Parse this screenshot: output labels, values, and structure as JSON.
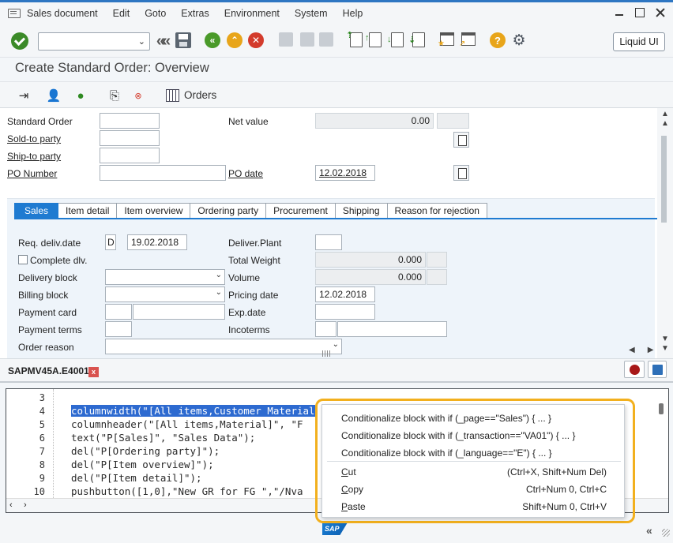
{
  "menu": [
    "Sales document",
    "Edit",
    "Goto",
    "Extras",
    "Environment",
    "System",
    "Help"
  ],
  "toolbar": {
    "liquid_ui": "Liquid UI"
  },
  "title": "Create Standard Order: Overview",
  "toolbar2": {
    "orders": "Orders"
  },
  "header": {
    "standard_order": "Standard Order",
    "sold_to": "Sold-to party",
    "ship_to": "Ship-to party",
    "po_number": "PO Number",
    "net_value": "Net value",
    "net_value_val": "0.00",
    "po_date": "PO date",
    "po_date_val": "12.02.2018"
  },
  "tabs": [
    "Sales",
    "Item detail",
    "Item overview",
    "Ordering party",
    "Procurement",
    "Shipping",
    "Reason for rejection"
  ],
  "sales": {
    "req_deliv": "Req. deliv.date",
    "req_deliv_d": "D",
    "req_deliv_val": "19.02.2018",
    "complete_dlv": "Complete dlv.",
    "delivery_block": "Delivery block",
    "billing_block": "Billing block",
    "payment_card": "Payment card",
    "payment_terms": "Payment terms",
    "order_reason": "Order reason",
    "deliver_plant": "Deliver.Plant",
    "total_weight": "Total Weight",
    "total_weight_val": "0.000",
    "volume": "Volume",
    "volume_val": "0.000",
    "pricing_date": "Pricing date",
    "pricing_date_val": "12.02.2018",
    "exp_date": "Exp.date",
    "incoterms": "Incoterms"
  },
  "editor": {
    "tab_title": "SAPMV45A.E4001",
    "close": "x",
    "lines": [
      {
        "n": "3",
        "code": ""
      },
      {
        "n": "4",
        "code": "columnwidth(\"[All items,Customer Material"
      },
      {
        "n": "5",
        "code": "columnheader(\"[All items,Material]\", \"F"
      },
      {
        "n": "6",
        "code": "text(\"P[Sales]\", \"Sales Data\");"
      },
      {
        "n": "7",
        "code": "del(\"P[Ordering party]\");"
      },
      {
        "n": "8",
        "code": "del(\"P[Item overview]\");"
      },
      {
        "n": "9",
        "code": "del(\"P[Item detail]\");"
      },
      {
        "n": "10",
        "code": "pushbutton([1,0],\"New GR for FG \",\"/Nva"
      }
    ]
  },
  "context_menu": {
    "cond_page": "Conditionalize block with if (_page==\"Sales\") { ... }",
    "cond_transaction": "Conditionalize block with if (_transaction==\"VA01\") { ... }",
    "cond_language": "Conditionalize block with if (_language==\"E\") { ... }",
    "cut": "Cut",
    "cut_shortcut": "(Ctrl+X, Shift+Num Del)",
    "copy": "Copy",
    "copy_shortcut": "Ctrl+Num 0, Ctrl+C",
    "paste": "Paste",
    "paste_shortcut": "Shift+Num 0, Ctrl+V"
  },
  "status": {
    "logo": "SAP"
  },
  "colors": {
    "accent": "#1f7bd1",
    "highlight": "#f2b01e",
    "selection": "#2d6ad0"
  }
}
